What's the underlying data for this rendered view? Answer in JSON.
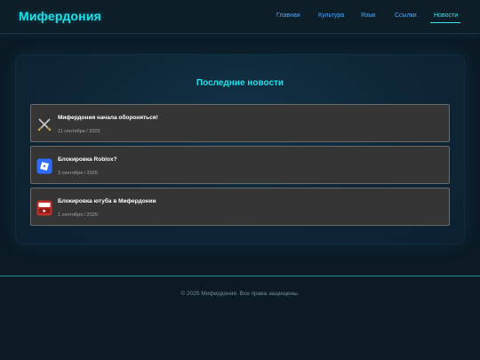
{
  "header": {
    "logo": "Мифердония",
    "nav": [
      {
        "label": "Главная"
      },
      {
        "label": "Культура"
      },
      {
        "label": "Язык"
      },
      {
        "label": "Ссылки"
      },
      {
        "label": "Новости",
        "active": true
      }
    ]
  },
  "main": {
    "title": "Последние новости",
    "news": [
      {
        "icon": "crossed-swords-icon",
        "title": "Мифердония начала обороняться!",
        "date": "11 сентября / 2025"
      },
      {
        "icon": "roblox-logo-icon",
        "title": "Блокировка Roblox?",
        "date": "3 сентября / 2025"
      },
      {
        "icon": "youtube-logo-icon",
        "title": "Блокировка ютуба в Мифердонии",
        "date": "1 сентября / 2025"
      }
    ]
  },
  "footer": {
    "copyright": "© 2025 Мифердония. Все права защищены."
  },
  "colors": {
    "accent": "#1ee0e8",
    "nav_link": "#4fa9ff",
    "background": "#0b1a24",
    "card": "#353535"
  }
}
